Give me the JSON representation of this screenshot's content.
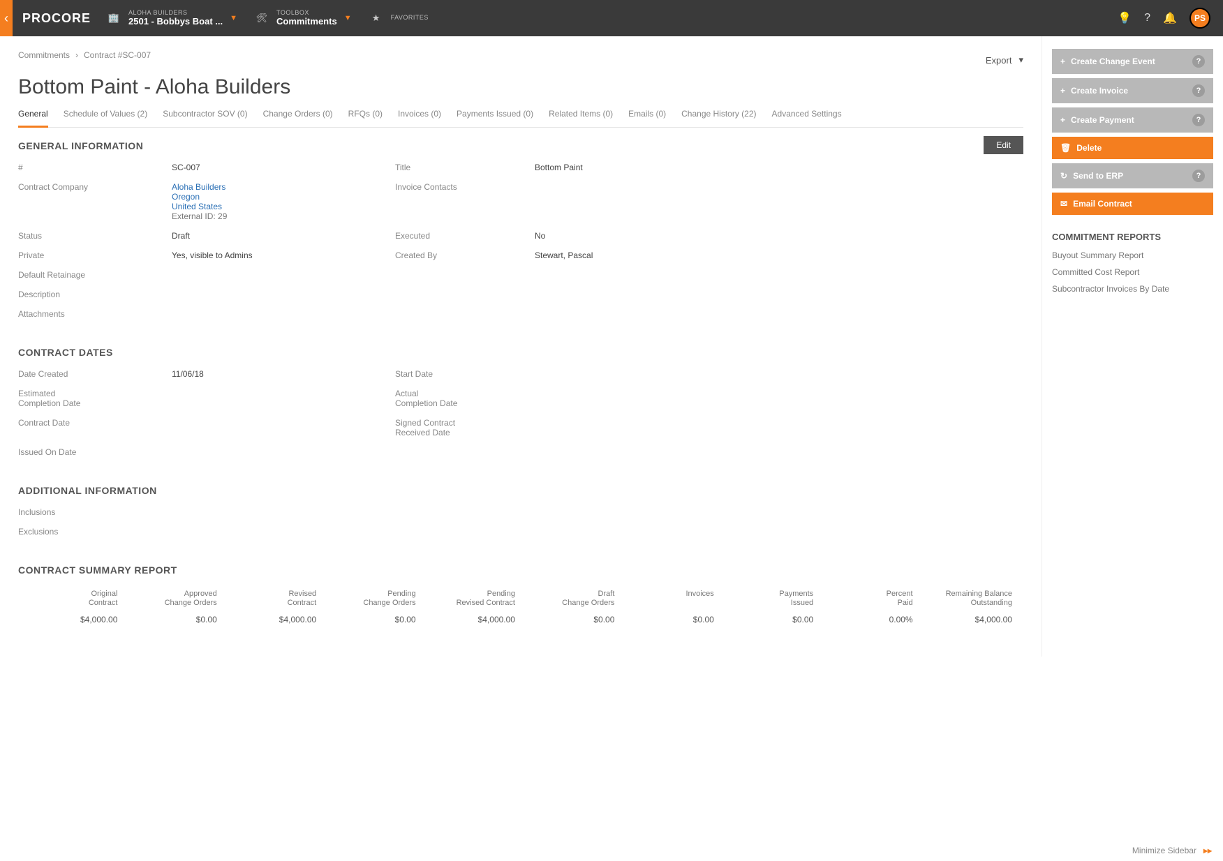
{
  "topbar": {
    "logo": "PROCORE",
    "company_label": "ALOHA BUILDERS",
    "company_value": "2501 - Bobbys Boat ...",
    "toolbox_label": "TOOLBOX",
    "toolbox_value": "Commitments",
    "favorites_label": "FAVORITES",
    "avatar_initials": "PS"
  },
  "breadcrumb": {
    "root": "Commitments",
    "current": "Contract #SC-007",
    "export": "Export"
  },
  "page_title": "Bottom Paint - Aloha Builders",
  "tabs": [
    "General",
    "Schedule of Values (2)",
    "Subcontractor SOV (0)",
    "Change Orders (0)",
    "RFQs (0)",
    "Invoices (0)",
    "Payments Issued (0)",
    "Related Items (0)",
    "Emails (0)",
    "Change History (22)",
    "Advanced Settings"
  ],
  "edit_label": "Edit",
  "sections": {
    "general_info": {
      "heading": "GENERAL INFORMATION",
      "fields": {
        "number_label": "#",
        "number_value": "SC-007",
        "title_label": "Title",
        "title_value": "Bottom Paint",
        "company_label": "Contract Company",
        "company_link1": "Aloha Builders",
        "company_link2": "Oregon",
        "company_link3": "United States",
        "company_sub": "External ID: 29",
        "invoice_contacts_label": "Invoice Contacts",
        "invoice_contacts_value": "",
        "status_label": "Status",
        "status_value": "Draft",
        "executed_label": "Executed",
        "executed_value": "No",
        "private_label": "Private",
        "private_value": "Yes, visible to Admins",
        "created_by_label": "Created By",
        "created_by_value": "Stewart, Pascal",
        "retainage_label": "Default Retainage",
        "description_label": "Description",
        "attachments_label": "Attachments"
      }
    },
    "contract_dates": {
      "heading": "CONTRACT DATES",
      "fields": {
        "date_created_label": "Date Created",
        "date_created_value": "11/06/18",
        "start_date_label": "Start Date",
        "est_completion_label": "Estimated\nCompletion Date",
        "actual_completion_label": "Actual\nCompletion Date",
        "contract_date_label": "Contract Date",
        "signed_received_label": "Signed Contract\nReceived Date",
        "issued_on_label": "Issued On Date"
      }
    },
    "additional": {
      "heading": "ADDITIONAL INFORMATION",
      "inclusions_label": "Inclusions",
      "exclusions_label": "Exclusions"
    },
    "summary": {
      "heading": "CONTRACT SUMMARY REPORT",
      "headers": [
        "Original\nContract",
        "Approved\nChange Orders",
        "Revised\nContract",
        "Pending\nChange Orders",
        "Pending\nRevised Contract",
        "Draft\nChange Orders",
        "Invoices",
        "Payments\nIssued",
        "Percent\nPaid",
        "Remaining Balance\nOutstanding"
      ],
      "values": [
        "$4,000.00",
        "$0.00",
        "$4,000.00",
        "$0.00",
        "$4,000.00",
        "$0.00",
        "$0.00",
        "$0.00",
        "0.00%",
        "$4,000.00"
      ]
    }
  },
  "sidebar": {
    "buttons": [
      {
        "icon": "+",
        "label": "Create Change Event",
        "style": "gray",
        "info": true
      },
      {
        "icon": "+",
        "label": "Create Invoice",
        "style": "gray",
        "info": true
      },
      {
        "icon": "+",
        "label": "Create Payment",
        "style": "gray",
        "info": true
      },
      {
        "icon": "🗑",
        "label": "Delete",
        "style": "orange",
        "info": false
      },
      {
        "icon": "↻",
        "label": "Send to ERP",
        "style": "gray",
        "info": true
      },
      {
        "icon": "✉",
        "label": "Email Contract",
        "style": "orange",
        "info": false
      }
    ],
    "reports_heading": "COMMITMENT REPORTS",
    "reports": [
      "Buyout Summary Report",
      "Committed Cost Report",
      "Subcontractor Invoices By Date"
    ],
    "minimize": "Minimize Sidebar"
  }
}
